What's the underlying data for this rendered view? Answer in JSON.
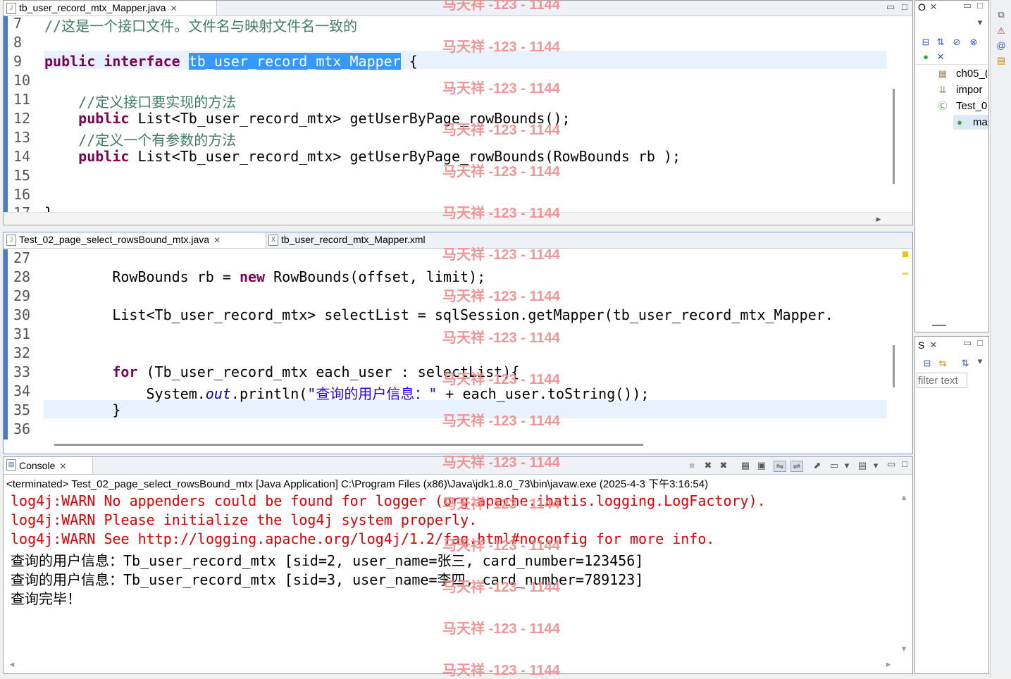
{
  "top_editor": {
    "tab_label": "tb_user_record_mtx_Mapper.java",
    "lines": [
      {
        "num": "7",
        "text": "//这是一个接口文件。文件名与映射文件名一致的"
      },
      {
        "num": "8",
        "text": ""
      },
      {
        "num": "9",
        "keyword": "public interface ",
        "selected": "tb_user_record_mtx_Mapper",
        "rest": " {"
      },
      {
        "num": "10",
        "text": ""
      },
      {
        "num": "11",
        "text": "    //定义接口要实现的方法"
      },
      {
        "num": "12",
        "keyword": "    public ",
        "rest": "List<Tb_user_record_mtx> getUserByPage_rowBounds();"
      },
      {
        "num": "13",
        "text": "    //定义一个有参数的方法"
      },
      {
        "num": "14",
        "keyword": "    public ",
        "rest": "List<Tb_user_record_mtx> getUserByPage_rowBounds(RowBounds rb );"
      },
      {
        "num": "15",
        "text": ""
      },
      {
        "num": "16",
        "text": ""
      },
      {
        "num": "17",
        "text": "}"
      }
    ]
  },
  "bottom_editor": {
    "tabs": [
      {
        "label": "Test_02_page_select_rowsBound_mtx.java",
        "active": true
      },
      {
        "label": "tb_user_record_mtx_Mapper.xml",
        "active": false
      }
    ],
    "lines": [
      {
        "num": "27",
        "text": ""
      },
      {
        "num": "28",
        "pre": "        RowBounds rb = ",
        "keyword": "new",
        "rest": " RowBounds(offset, limit);"
      },
      {
        "num": "29",
        "text": ""
      },
      {
        "num": "30",
        "text": "        List<Tb_user_record_mtx> selectList = sqlSession.getMapper(tb_user_record_mtx_Mapper."
      },
      {
        "num": "31",
        "text": ""
      },
      {
        "num": "32",
        "text": ""
      },
      {
        "num": "33",
        "pre": "        ",
        "keyword": "for",
        "rest": " (Tb_user_record_mtx each_user : selectList){"
      },
      {
        "num": "34",
        "pre": "            System.",
        "italic": "out",
        "mid": ".println(",
        "string": "\"查询的用户信息：\"",
        "rest": " + each_user.toString());"
      },
      {
        "num": "35",
        "text": "        }"
      },
      {
        "num": "36",
        "text": ""
      }
    ]
  },
  "console": {
    "tab_label": "Console",
    "status": "<terminated> Test_02_page_select_rowsBound_mtx [Java Application] C:\\Program Files (x86)\\Java\\jdk1.8.0_73\\bin\\javaw.exe (2025-4-3 下午3:16:54)",
    "lines": [
      {
        "text": "log4j:WARN No appenders could be found for logger (org.apache.ibatis.logging.LogFactory).",
        "warn": true
      },
      {
        "text": "log4j:WARN Please initialize the log4j system properly.",
        "warn": true
      },
      {
        "text": "log4j:WARN See http://logging.apache.org/log4j/1.2/faq.html#noconfig for more info.",
        "warn": true
      },
      {
        "text": "查询的用户信息：Tb_user_record_mtx [sid=2, user_name=张三, card_number=123456]",
        "warn": false
      },
      {
        "text": "查询的用户信息：Tb_user_record_mtx [sid=3, user_name=李四, card_number=789123]",
        "warn": false
      },
      {
        "text": "查询完毕！",
        "warn": false
      }
    ]
  },
  "outline": {
    "tab_label": "O",
    "items": [
      "ch05_(",
      "impor",
      "Test_0",
      "ma"
    ]
  },
  "search_view": {
    "tab_label": "S",
    "filter_placeholder": "filter text"
  },
  "watermark": "马天祥 -123 - 1144"
}
